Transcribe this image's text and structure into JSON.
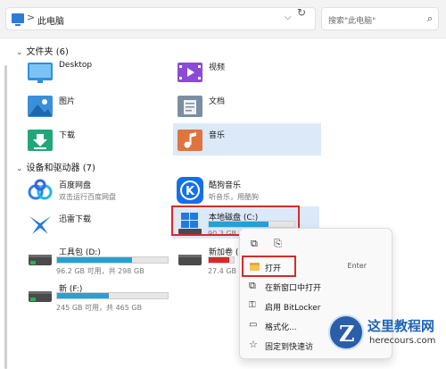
{
  "address": {
    "path": "此电脑",
    "separator": ">"
  },
  "search": {
    "placeholder": "搜索\"此电脑\""
  },
  "folders_section": {
    "title": "文件夹 (6)"
  },
  "folders": [
    {
      "label": "Desktop",
      "icon": "desktop-folder-icon"
    },
    {
      "label": "视频",
      "icon": "videos-folder-icon"
    },
    {
      "label": "图片",
      "icon": "pictures-folder-icon"
    },
    {
      "label": "文档",
      "icon": "documents-folder-icon"
    },
    {
      "label": "下载",
      "icon": "downloads-folder-icon"
    },
    {
      "label": "音乐",
      "icon": "music-folder-icon"
    }
  ],
  "devices_section": {
    "title": "设备和驱动器 (7)"
  },
  "devices": {
    "baidu": {
      "name": "百度网盘",
      "sub": "双击运行百度网盘"
    },
    "kugou": {
      "name": "酷狗音乐",
      "sub": "听音乐，用酷狗"
    },
    "xunlei": {
      "name": "迅雷下载"
    },
    "drive_c": {
      "name": "本地磁盘 (C:)",
      "caption": "90.3 GB",
      "used_fraction": 0.7
    },
    "drive_d": {
      "name": "工具包 (D:)",
      "caption": "96.2 GB 可用，共 298 GB",
      "used_fraction": 0.68
    },
    "drive_e": {
      "name": "新加卷 (E:)",
      "caption": "27.4 GB 可用",
      "used_fraction": 0.82
    },
    "drive_f": {
      "name": "新 (F:)",
      "caption": "245 GB 可用，共 465 GB",
      "used_fraction": 0.47
    }
  },
  "context_menu": {
    "open": {
      "label": "打开",
      "shortcut": "Enter"
    },
    "new_window": {
      "label": "在新窗口中打开"
    },
    "bitlocker": {
      "label": "启用 BitLocker"
    },
    "format": {
      "label": "格式化..."
    },
    "pin": {
      "label": "固定到快速访"
    }
  },
  "watermark": {
    "title": "这里教程网",
    "url": "herecours.com"
  },
  "colors": {
    "accent": "#26a0da",
    "selection": "#dbe9f8",
    "highlight_box": "#d52b2b",
    "drive_full": "#da2626"
  }
}
